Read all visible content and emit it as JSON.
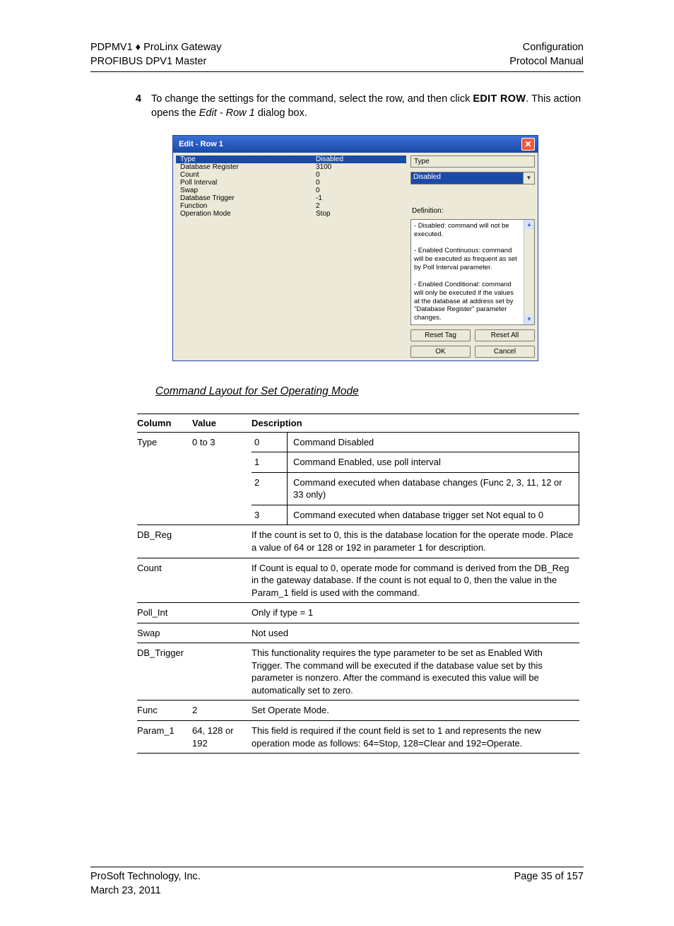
{
  "header": {
    "left1": "PDPMV1 ♦ ProLinx Gateway",
    "left2": "PROFIBUS DPV1 Master",
    "right1": "Configuration",
    "right2": "Protocol Manual"
  },
  "step": {
    "num": "4",
    "pre": "To change the settings for the command, select the row, and then click ",
    "bold1": "EDIT ROW",
    "mid": ". This action opens the ",
    "ital": "Edit - Row 1",
    "post": " dialog box."
  },
  "dialog": {
    "title": "Edit - Row 1",
    "close": "✕",
    "props": [
      {
        "k": "Type",
        "v": "Disabled",
        "sel": true
      },
      {
        "k": "Database Register",
        "v": "3100"
      },
      {
        "k": "Count",
        "v": "0"
      },
      {
        "k": "Poll Interval",
        "v": "0"
      },
      {
        "k": "Swap",
        "v": "0"
      },
      {
        "k": "Database Trigger",
        "v": "-1"
      },
      {
        "k": "Function",
        "v": "2"
      },
      {
        "k": "Operation Mode",
        "v": "Stop"
      }
    ],
    "fieldLabel": "Type",
    "dropdownValue": "Disabled",
    "defLabel": "Definition:",
    "defText": "- Disabled: command will not be executed.\n\n- Enabled Continuous: command will be executed as frequent as set by Poll Interval parameter.\n\n- Enabled Conditional: command will only be executed if the values at the database at address set by \"Database Register\" parameter changes.\n\n- Enabled With Trigger:",
    "btnResetTag": "Reset Tag",
    "btnResetAll": "Reset All",
    "btnOK": "OK",
    "btnCancel": "Cancel"
  },
  "sectionTitle": "Command Layout for Set Operating Mode",
  "table": {
    "h1": "Column",
    "h2": "Value",
    "h3": "Description",
    "rows": {
      "type": {
        "col": "Type",
        "val": "0 to 3",
        "sub": [
          {
            "n": "0",
            "d": "Command Disabled"
          },
          {
            "n": "1",
            "d": "Command Enabled, use poll interval"
          },
          {
            "n": "2",
            "d": "Command executed when database changes (Func 2, 3, 11, 12 or 33 only)"
          },
          {
            "n": "3",
            "d": "Command executed when database trigger set Not equal to 0"
          }
        ]
      },
      "dbreg": {
        "col": "DB_Reg",
        "val": "",
        "d": "If the count is set to 0, this is the database location for the operate mode. Place a value of 64 or 128 or 192 in parameter 1 for description."
      },
      "count": {
        "col": "Count",
        "val": "",
        "d": "If Count is equal to 0, operate mode for command is derived from the DB_Reg in the gateway database. If the count is not equal to 0, then the value in the Param_1 field is used with the command."
      },
      "pollint": {
        "col": "Poll_Int",
        "val": "",
        "d": "Only if type = 1"
      },
      "swap": {
        "col": "Swap",
        "val": "",
        "d": "Not used"
      },
      "dbtrig": {
        "col": "DB_Trigger",
        "val": "",
        "d": "This functionality requires the type parameter to be set as Enabled With Trigger. The command will be executed if the database value set by this parameter is nonzero. After the command is executed this value will be automatically set to zero."
      },
      "func": {
        "col": "Func",
        "val": "2",
        "d": "Set Operate Mode."
      },
      "param1": {
        "col": "Param_1",
        "val": "64, 128 or 192",
        "d": "This field is required if the count field is set to 1 and represents the new operation mode as follows: 64=Stop, 128=Clear and 192=Operate."
      }
    }
  },
  "footer": {
    "left1": "ProSoft Technology, Inc.",
    "left2": "March 23, 2011",
    "right1": "Page 35 of 157"
  }
}
